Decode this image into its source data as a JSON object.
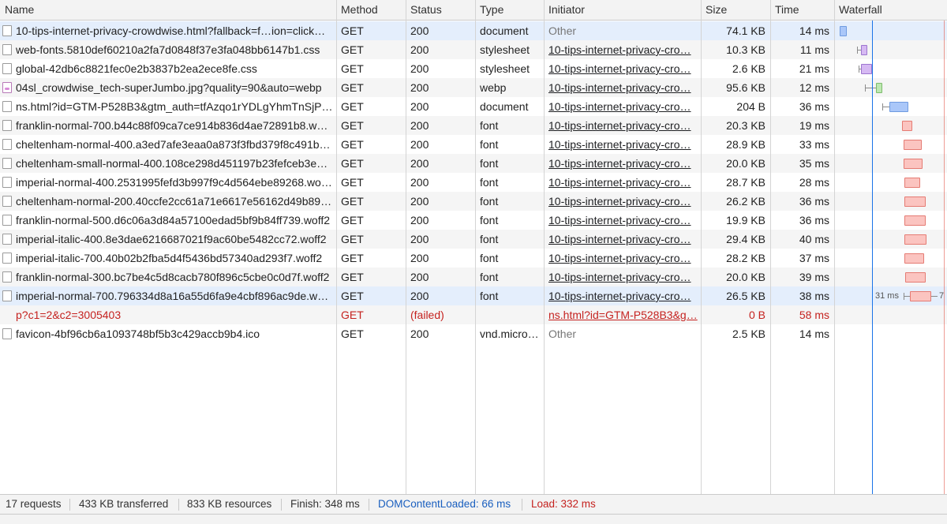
{
  "columns": {
    "name": "Name",
    "method": "Method",
    "status": "Status",
    "type": "Type",
    "initiator": "Initiator",
    "size": "Size",
    "time": "Time",
    "waterfall": "Waterfall"
  },
  "rows": [
    {
      "icon": "document-icon",
      "name": "10-tips-internet-privacy-crowdwise.html?fallback=f…ion=click…",
      "method": "GET",
      "status": "200",
      "type": "document",
      "initiator": "Other",
      "size": "74.1 KB",
      "time": "14 ms"
    },
    {
      "icon": "document-icon",
      "name": "web-fonts.5810def60210a2fa7d0848f37e3fa048bb6147b1.css",
      "method": "GET",
      "status": "200",
      "type": "stylesheet",
      "initiator": "10-tips-internet-privacy-cro…",
      "size": "10.3 KB",
      "time": "11 ms"
    },
    {
      "icon": "document-icon",
      "name": "global-42db6c8821fec0e2b3837b2ea2ece8fe.css",
      "method": "GET",
      "status": "200",
      "type": "stylesheet",
      "initiator": "10-tips-internet-privacy-cro…",
      "size": "2.6 KB",
      "time": "21 ms"
    },
    {
      "icon": "image-icon",
      "name": "04sl_crowdwise_tech-superJumbo.jpg?quality=90&auto=webp",
      "method": "GET",
      "status": "200",
      "type": "webp",
      "initiator": "10-tips-internet-privacy-cro…",
      "size": "95.6 KB",
      "time": "12 ms"
    },
    {
      "icon": "document-icon",
      "name": "ns.html?id=GTM-P528B3&gtm_auth=tfAzqo1rYDLgYhmTnSjP…",
      "method": "GET",
      "status": "200",
      "type": "document",
      "initiator": "10-tips-internet-privacy-cro…",
      "size": "204 B",
      "time": "36 ms"
    },
    {
      "icon": "file-icon",
      "name": "franklin-normal-700.b44c88f09ca7ce914b836d4ae72891b8.wo…",
      "method": "GET",
      "status": "200",
      "type": "font",
      "initiator": "10-tips-internet-privacy-cro…",
      "size": "20.3 KB",
      "time": "19 ms"
    },
    {
      "icon": "file-icon",
      "name": "cheltenham-normal-400.a3ed7afe3eaa0a873f3fbd379f8c491b.…",
      "method": "GET",
      "status": "200",
      "type": "font",
      "initiator": "10-tips-internet-privacy-cro…",
      "size": "28.9 KB",
      "time": "33 ms"
    },
    {
      "icon": "file-icon",
      "name": "cheltenham-small-normal-400.108ce298d451197b23fefceb3e3…",
      "method": "GET",
      "status": "200",
      "type": "font",
      "initiator": "10-tips-internet-privacy-cro…",
      "size": "20.0 KB",
      "time": "35 ms"
    },
    {
      "icon": "file-icon",
      "name": "imperial-normal-400.2531995fefd3b997f9c4d564ebe89268.woff2",
      "method": "GET",
      "status": "200",
      "type": "font",
      "initiator": "10-tips-internet-privacy-cro…",
      "size": "28.7 KB",
      "time": "28 ms"
    },
    {
      "icon": "file-icon",
      "name": "cheltenham-normal-200.40ccfe2cc61a71e6617e56162d49b89…",
      "method": "GET",
      "status": "200",
      "type": "font",
      "initiator": "10-tips-internet-privacy-cro…",
      "size": "26.2 KB",
      "time": "36 ms"
    },
    {
      "icon": "file-icon",
      "name": "franklin-normal-500.d6c06a3d84a57100edad5bf9b84ff739.woff2",
      "method": "GET",
      "status": "200",
      "type": "font",
      "initiator": "10-tips-internet-privacy-cro…",
      "size": "19.9 KB",
      "time": "36 ms"
    },
    {
      "icon": "file-icon",
      "name": "imperial-italic-400.8e3dae6216687021f9ac60be5482cc72.woff2",
      "method": "GET",
      "status": "200",
      "type": "font",
      "initiator": "10-tips-internet-privacy-cro…",
      "size": "29.4 KB",
      "time": "40 ms"
    },
    {
      "icon": "file-icon",
      "name": "imperial-italic-700.40b02b2fba5d4f5436bd57340ad293f7.woff2",
      "method": "GET",
      "status": "200",
      "type": "font",
      "initiator": "10-tips-internet-privacy-cro…",
      "size": "28.2 KB",
      "time": "37 ms"
    },
    {
      "icon": "file-icon",
      "name": "franklin-normal-300.bc7be4c5d8cacb780f896c5cbe0c0d7f.woff2",
      "method": "GET",
      "status": "200",
      "type": "font",
      "initiator": "10-tips-internet-privacy-cro…",
      "size": "20.0 KB",
      "time": "39 ms"
    },
    {
      "icon": "file-icon",
      "name": "imperial-normal-700.796334d8a16a55d6fa9e4cbf896ac9de.wo…",
      "method": "GET",
      "status": "200",
      "type": "font",
      "initiator": "10-tips-internet-privacy-cro…",
      "size": "26.5 KB",
      "time": "38 ms",
      "waterfall_tooltip": "31 ms",
      "waterfall_tooltip_right": "7"
    },
    {
      "icon": "none",
      "name": "p?c1=2&c2=3005403",
      "method": "GET",
      "status": "(failed)",
      "type": "",
      "initiator": "ns.html?id=GTM-P528B3&g…",
      "size": "0 B",
      "time": "58 ms",
      "failed": true
    },
    {
      "icon": "file-icon",
      "name": "favicon-4bf96cb6a1093748bf5b3c429accb9b4.ico",
      "method": "GET",
      "status": "200",
      "type": "vnd.micro…",
      "initiator": "Other",
      "size": "2.5 KB",
      "time": "14 ms"
    }
  ],
  "status_bar": {
    "requests": "17 requests",
    "transferred": "433 KB transferred",
    "resources": "833 KB resources",
    "finish": "Finish: 348 ms",
    "dom_content_loaded": "DOMContentLoaded: 66 ms",
    "load": "Load: 332 ms"
  },
  "colors": {
    "dcl_line": "#1a73e8",
    "load_line": "#e03b2b",
    "failed_text": "#c5221f",
    "selected_row": "#e4eefc"
  }
}
